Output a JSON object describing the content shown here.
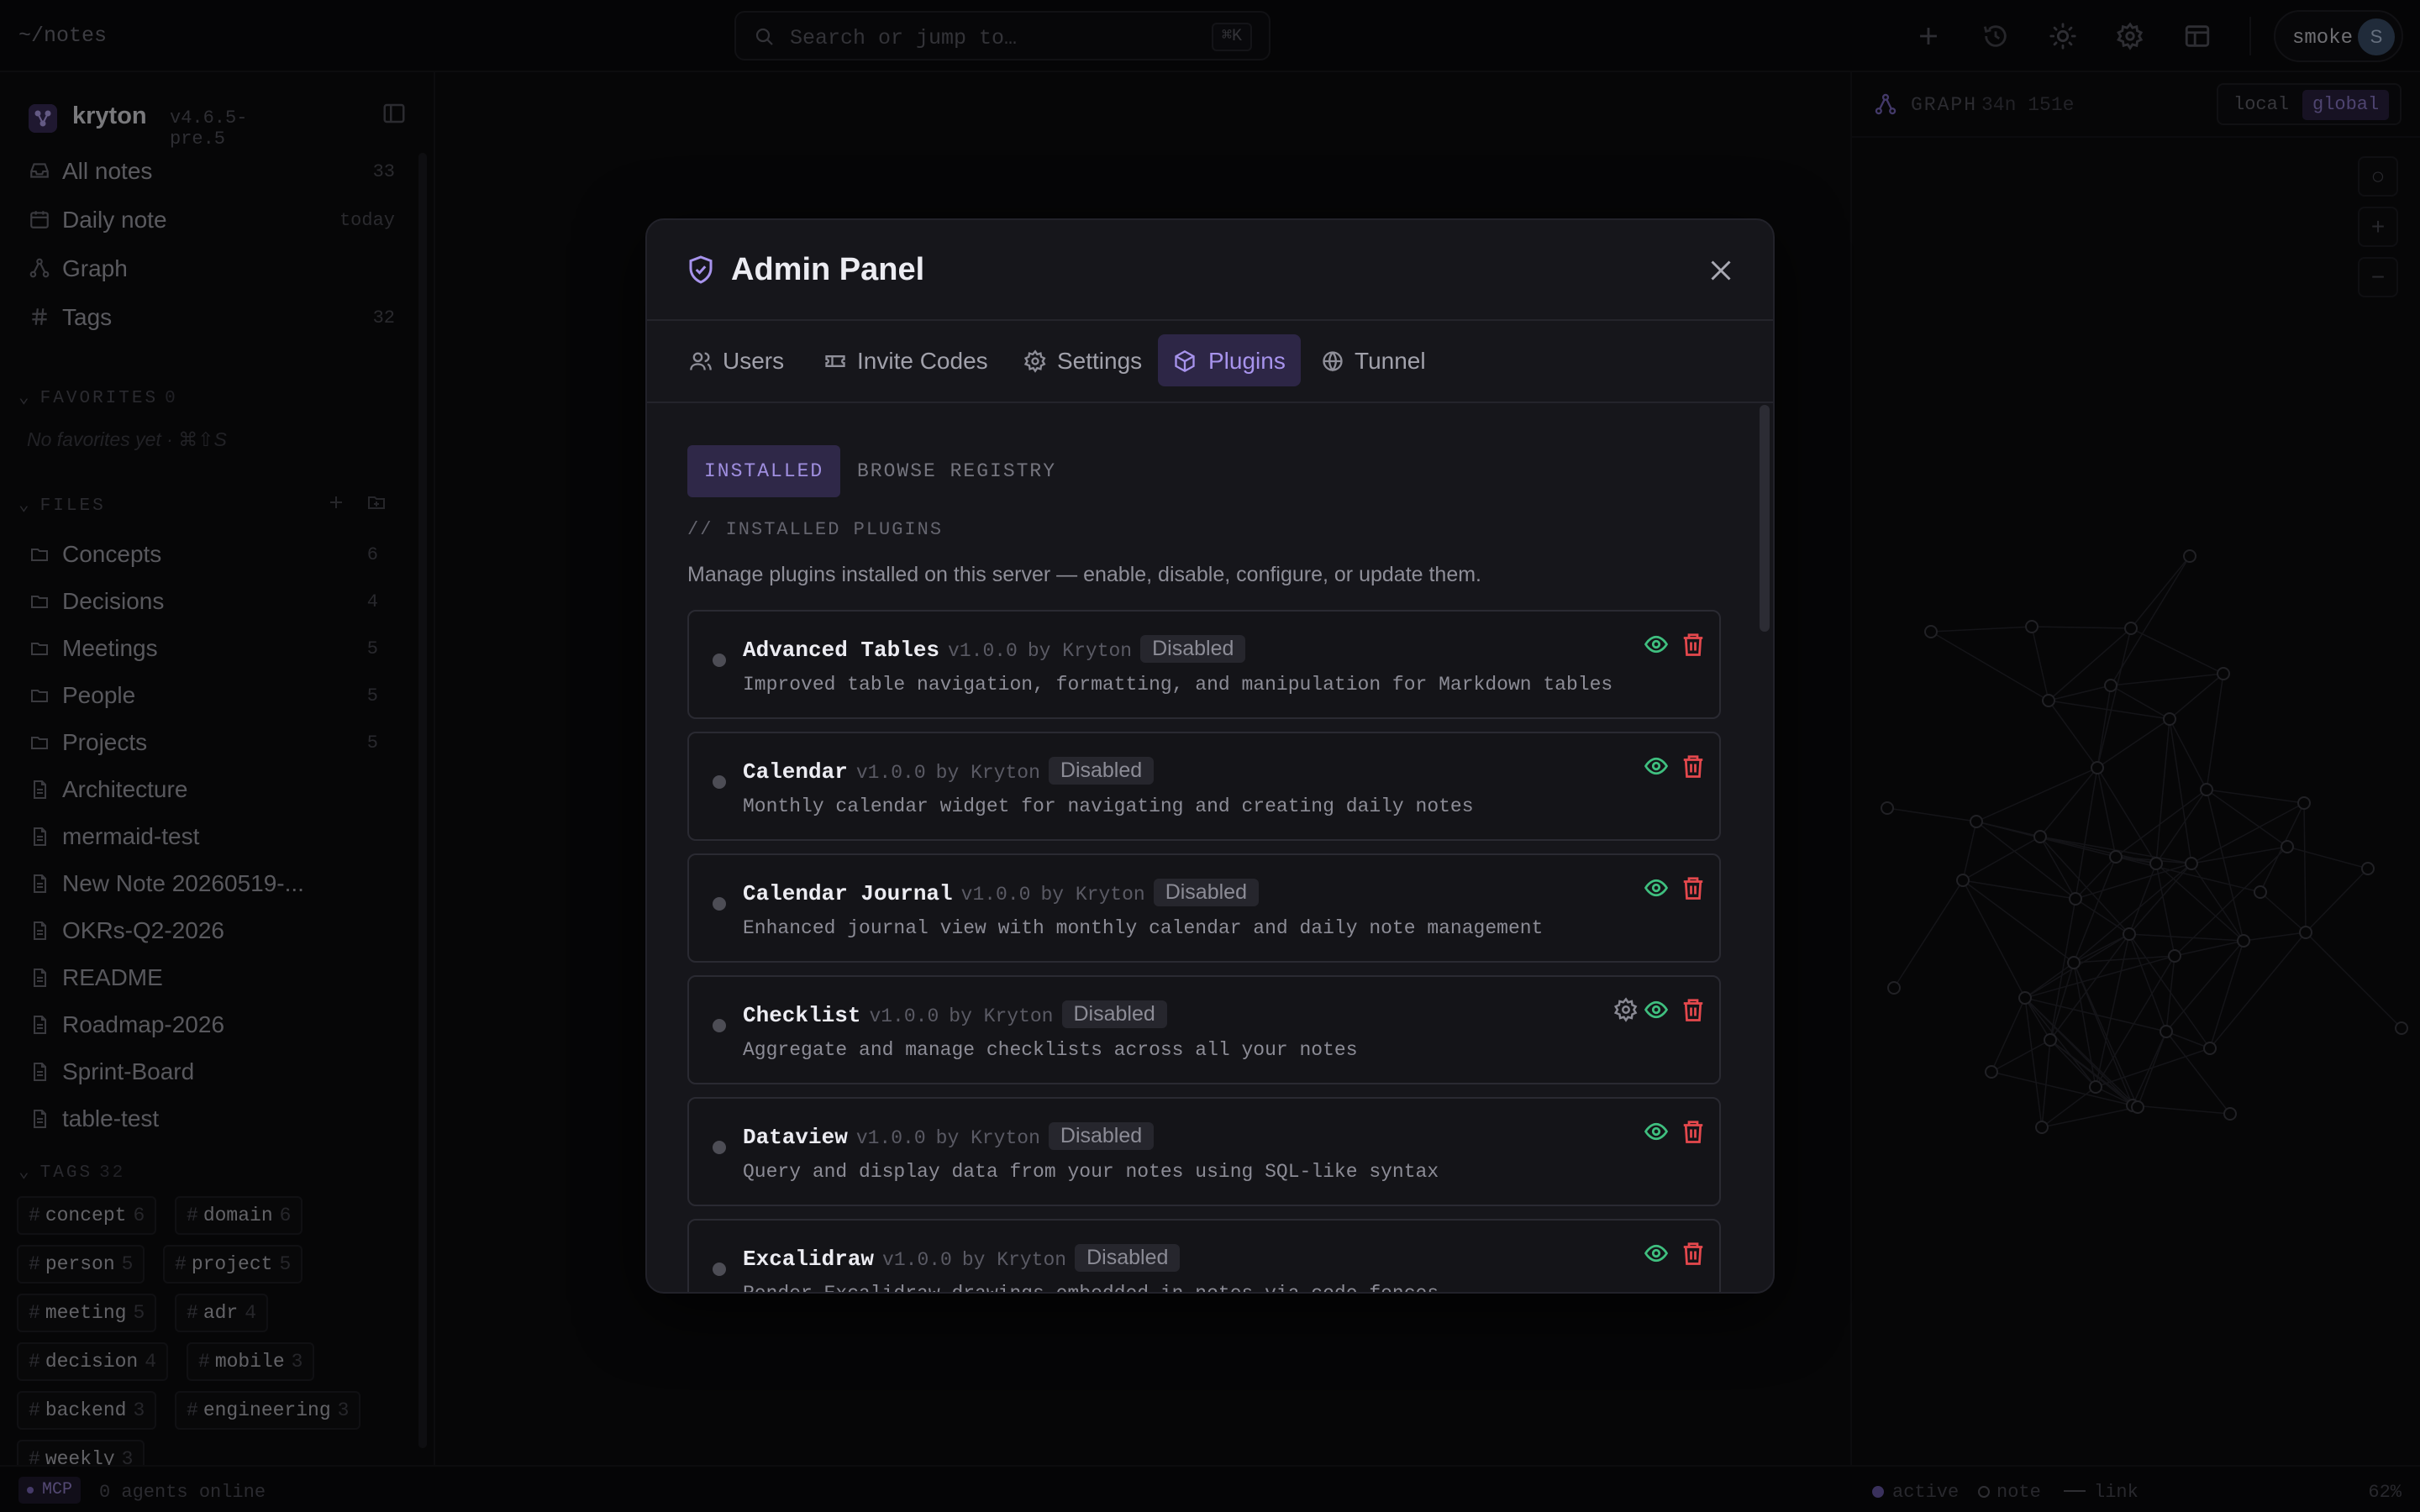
{
  "topbar": {
    "path": "~/notes",
    "search_placeholder": "Search or jump to…",
    "search_shortcut": "⌘K",
    "user_name": "smoke",
    "user_initial": "S"
  },
  "sidebar": {
    "app_name": "kryton",
    "version": "v4.6.5-pre.5",
    "nav": [
      {
        "label": "All notes",
        "count": "33",
        "icon": "inbox-icon"
      },
      {
        "label": "Daily note",
        "count": "today",
        "icon": "calendar-icon"
      },
      {
        "label": "Graph",
        "count": "",
        "icon": "graph-icon"
      },
      {
        "label": "Tags",
        "count": "32",
        "icon": "hash-icon"
      }
    ],
    "favorites": {
      "title": "FAVORITES",
      "count": "0",
      "empty": "No favorites yet · ⌘⇧S"
    },
    "files": {
      "title": "FILES",
      "items": [
        {
          "label": "Concepts",
          "count": "6",
          "type": "folder"
        },
        {
          "label": "Decisions",
          "count": "4",
          "type": "folder"
        },
        {
          "label": "Meetings",
          "count": "5",
          "type": "folder"
        },
        {
          "label": "People",
          "count": "5",
          "type": "folder"
        },
        {
          "label": "Projects",
          "count": "5",
          "type": "folder"
        },
        {
          "label": "Architecture",
          "count": "",
          "type": "file"
        },
        {
          "label": "mermaid-test",
          "count": "",
          "type": "file"
        },
        {
          "label": "New Note 20260519-...",
          "count": "",
          "type": "file"
        },
        {
          "label": "OKRs-Q2-2026",
          "count": "",
          "type": "file"
        },
        {
          "label": "README",
          "count": "",
          "type": "file"
        },
        {
          "label": "Roadmap-2026",
          "count": "",
          "type": "file"
        },
        {
          "label": "Sprint-Board",
          "count": "",
          "type": "file"
        },
        {
          "label": "table-test",
          "count": "",
          "type": "file"
        }
      ]
    },
    "tags": {
      "title": "TAGS",
      "count": "32",
      "items": [
        {
          "name": "concept",
          "count": "6"
        },
        {
          "name": "domain",
          "count": "6"
        },
        {
          "name": "person",
          "count": "5"
        },
        {
          "name": "project",
          "count": "5"
        },
        {
          "name": "meeting",
          "count": "5"
        },
        {
          "name": "adr",
          "count": "4"
        },
        {
          "name": "decision",
          "count": "4"
        },
        {
          "name": "mobile",
          "count": "3"
        },
        {
          "name": "backend",
          "count": "3"
        },
        {
          "name": "engineering",
          "count": "3"
        },
        {
          "name": "weekly",
          "count": "3"
        }
      ]
    }
  },
  "graph": {
    "title": "GRAPH",
    "stats": "34n 151e",
    "scope_local": "local",
    "scope_global": "global",
    "tools": [
      "○",
      "+",
      "−"
    ]
  },
  "statusbar": {
    "mcp": "MCP",
    "agents": "0 agents online",
    "legend_active": "active",
    "legend_note": "note",
    "legend_link": "link",
    "zoom": "62%"
  },
  "modal": {
    "title": "Admin Panel",
    "tabs": [
      {
        "label": "Users",
        "icon": "users-icon"
      },
      {
        "label": "Invite Codes",
        "icon": "ticket-icon"
      },
      {
        "label": "Settings",
        "icon": "gear-icon"
      },
      {
        "label": "Plugins",
        "icon": "package-icon",
        "active": true
      },
      {
        "label": "Tunnel",
        "icon": "globe-icon"
      }
    ],
    "subtabs": {
      "installed": "INSTALLED",
      "browse": "BROWSE REGISTRY"
    },
    "section_label": "// INSTALLED PLUGINS",
    "section_desc": "Manage plugins installed on this server — enable, disable, configure, or update them.",
    "plugins": [
      {
        "name": "Advanced Tables",
        "version": "v1.0.0",
        "by": "by Kryton",
        "status": "Disabled",
        "desc": "Improved table navigation, formatting, and manipulation for Markdown tables",
        "has_settings": false
      },
      {
        "name": "Calendar",
        "version": "v1.0.0",
        "by": "by Kryton",
        "status": "Disabled",
        "desc": "Monthly calendar widget for navigating and creating daily notes",
        "has_settings": false
      },
      {
        "name": "Calendar Journal",
        "version": "v1.0.0",
        "by": "by Kryton",
        "status": "Disabled",
        "desc": "Enhanced journal view with monthly calendar and daily note management",
        "has_settings": false
      },
      {
        "name": "Checklist",
        "version": "v1.0.0",
        "by": "by Kryton",
        "status": "Disabled",
        "desc": "Aggregate and manage checklists across all your notes",
        "has_settings": true
      },
      {
        "name": "Dataview",
        "version": "v1.0.0",
        "by": "by Kryton",
        "status": "Disabled",
        "desc": "Query and display data from your notes using SQL-like syntax",
        "has_settings": false
      },
      {
        "name": "Excalidraw",
        "version": "v1.0.0",
        "by": "by Kryton",
        "status": "Disabled",
        "desc": "Render Excalidraw drawings embedded in notes via code fences",
        "has_settings": false
      }
    ]
  },
  "colors": {
    "accent": "#a793ec",
    "enable_icon": "#3fbf7f",
    "delete_icon": "#e5484d",
    "background": "#0b0b0e",
    "modal_bg": "#16161b"
  }
}
